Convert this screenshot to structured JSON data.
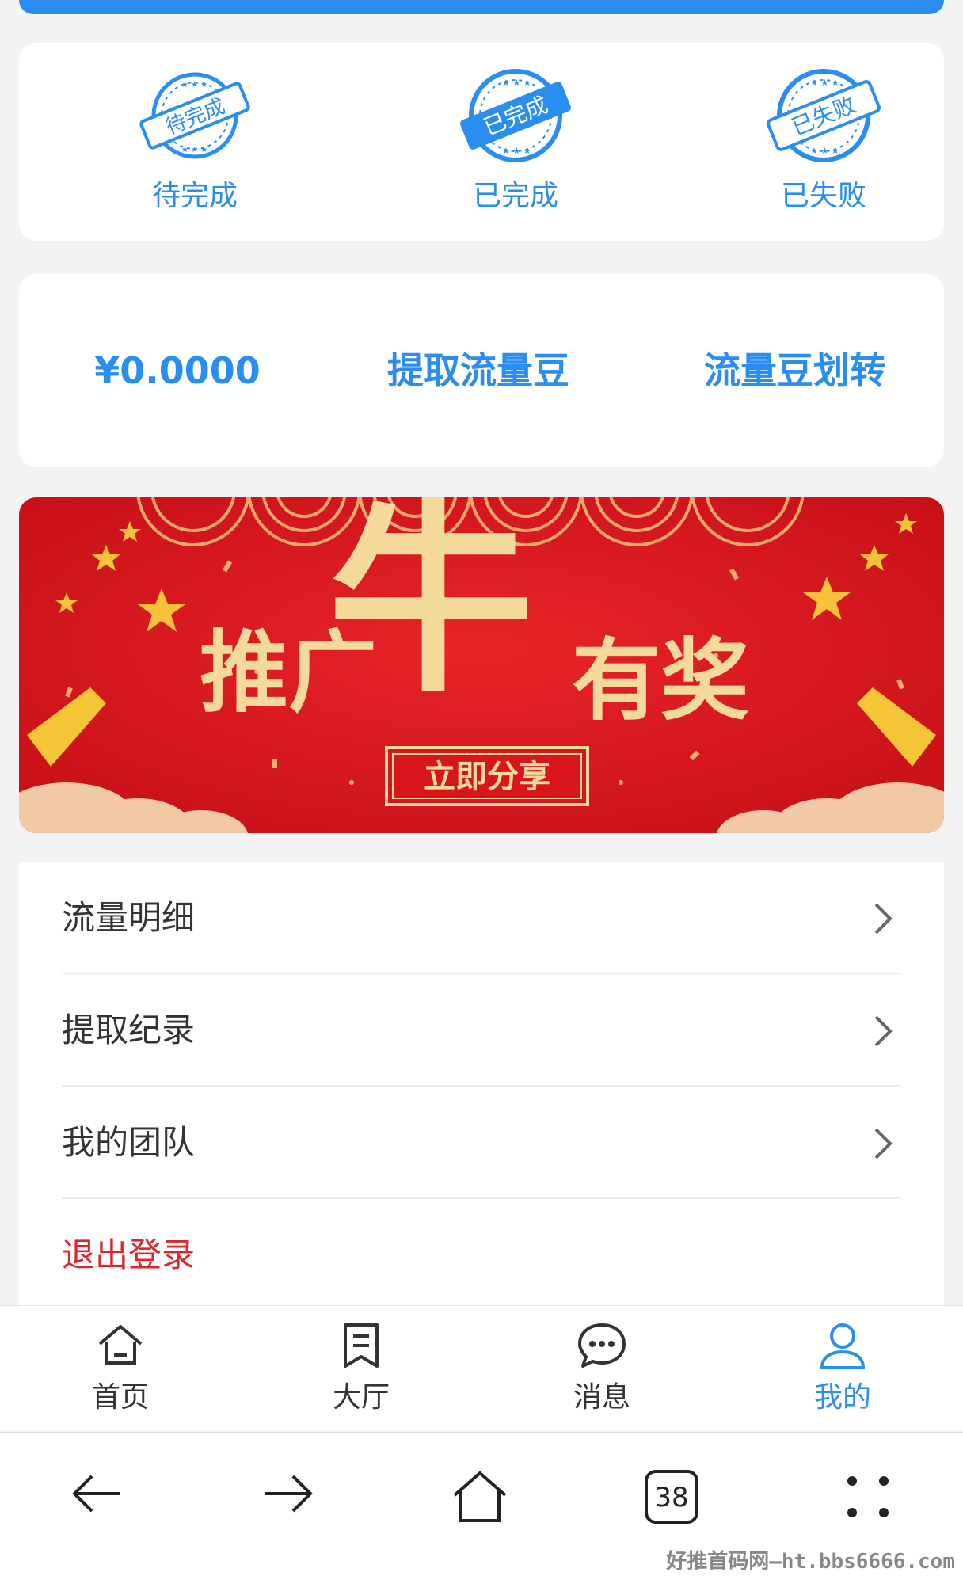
{
  "colors": {
    "accent": "#2a8df0",
    "danger": "#e0242c",
    "banner_red": "#d8141c",
    "banner_gold": "#f3d99a"
  },
  "status_cards": [
    {
      "label": "待完成",
      "stamp_text": "待完成",
      "stamp_icon": "pending-stamp-icon"
    },
    {
      "label": "已完成",
      "stamp_text": "已完成",
      "stamp_icon": "completed-stamp-icon"
    },
    {
      "label": "已失败",
      "stamp_text": "已失败",
      "stamp_icon": "failed-stamp-icon"
    }
  ],
  "balance": {
    "amount": "¥0.0000",
    "withdraw_label": "提取流量豆",
    "transfer_label": "流量豆划转"
  },
  "banner": {
    "char_large": "牛",
    "left_text": "推广",
    "right_text": "有奖",
    "button_text": "立即分享"
  },
  "menu": {
    "items": [
      {
        "label": "流量明细"
      },
      {
        "label": "提取纪录"
      },
      {
        "label": "我的团队"
      }
    ],
    "logout_label": "退出登录"
  },
  "tabbar": {
    "items": [
      {
        "label": "首页",
        "icon": "home-icon"
      },
      {
        "label": "大厅",
        "icon": "document-icon"
      },
      {
        "label": "消息",
        "icon": "chat-icon"
      },
      {
        "label": "我的",
        "icon": "user-icon"
      }
    ],
    "active_index": 3
  },
  "browser": {
    "tab_count": "38"
  },
  "watermark": "好推首码网—ht.bbs6666.com"
}
